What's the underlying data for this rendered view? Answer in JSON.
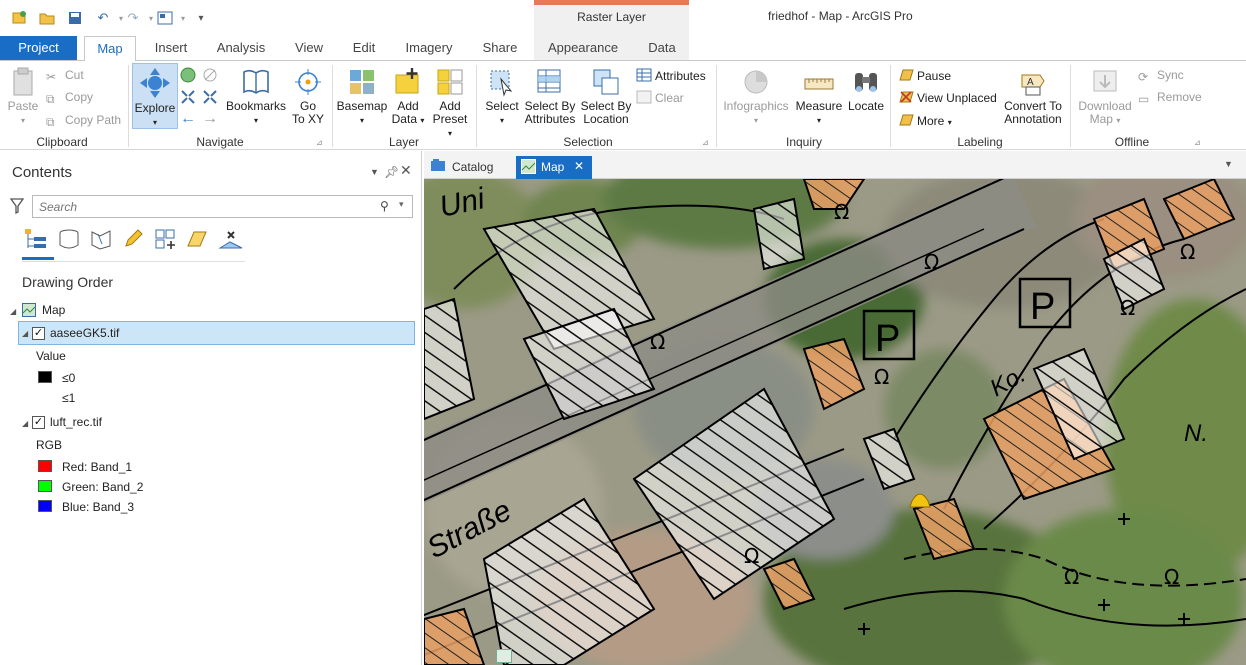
{
  "window": {
    "title": "friedhof - Map - ArcGIS Pro",
    "context_group": "Raster Layer"
  },
  "tabs": [
    "Project",
    "Map",
    "Insert",
    "Analysis",
    "View",
    "Edit",
    "Imagery",
    "Share",
    "Appearance",
    "Data"
  ],
  "ribbon": {
    "clipboard": {
      "label": "Clipboard",
      "paste": "Paste",
      "cut": "Cut",
      "copy": "Copy",
      "copy_path": "Copy Path"
    },
    "navigate": {
      "label": "Navigate",
      "explore": "Explore",
      "bookmarks": "Bookmarks",
      "goto_l1": "Go",
      "goto_l2": "To XY"
    },
    "layer": {
      "label": "Layer",
      "basemap": "Basemap",
      "add_data_l1": "Add",
      "add_data_l2": "Data",
      "add_preset_l1": "Add",
      "add_preset_l2": "Preset"
    },
    "selection": {
      "label": "Selection",
      "select": "Select",
      "sba_l1": "Select By",
      "sba_l2": "Attributes",
      "sbl_l1": "Select By",
      "sbl_l2": "Location",
      "attributes": "Attributes",
      "clear": "Clear"
    },
    "inquiry": {
      "label": "Inquiry",
      "infographics": "Infographics",
      "measure": "Measure",
      "locate": "Locate"
    },
    "labeling": {
      "label": "Labeling",
      "pause": "Pause",
      "view_unplaced": "View Unplaced",
      "more": "More",
      "convert_l1": "Convert To",
      "convert_l2": "Annotation"
    },
    "offline": {
      "label": "Offline",
      "download_l1": "Download",
      "download_l2": "Map",
      "sync": "Sync",
      "remove": "Remove"
    }
  },
  "contents": {
    "title": "Contents",
    "search_placeholder": "Search",
    "heading": "Drawing Order",
    "map_name": "Map",
    "layer1": {
      "name": "aaseeGK5.tif",
      "field": "Value",
      "class1": "≤0",
      "class2": "≤1"
    },
    "layer2": {
      "name": "luft_rec.tif",
      "mode": "RGB",
      "red": "Red:  Band_1",
      "green": "Green: Band_2",
      "blue": "Blue:  Band_3"
    }
  },
  "viewtabs": {
    "catalog": "Catalog",
    "map": "Map"
  },
  "map_labels": {
    "street1": "Uni",
    "street2": "Straße",
    "parking": "P",
    "ko": "Ko.",
    "n": "N."
  },
  "colors": {
    "accent": "#1a6dc5",
    "context": "#e8785a",
    "red": "#ff0000",
    "green": "#00ff00",
    "blue": "#0000ff"
  }
}
